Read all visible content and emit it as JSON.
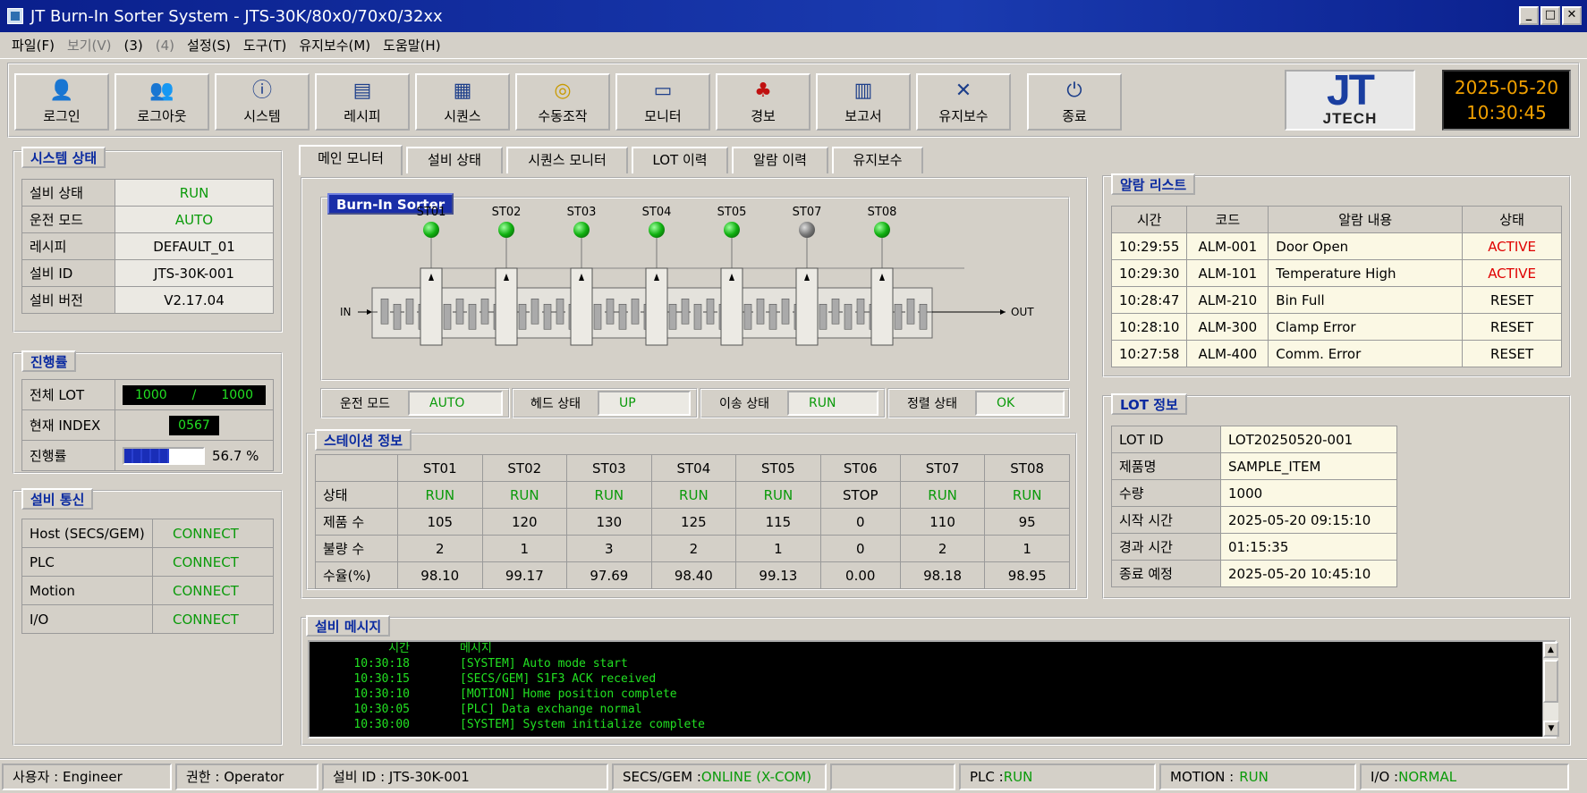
{
  "window": {
    "title": "JT Burn-In Sorter System - JTS-30K/80x0/70x0/32xx"
  },
  "menu": [
    "파일(F)",
    "보기(V)",
    "(3)",
    "(4)",
    "설정(S)",
    "도구(T)",
    "유지보수(M)",
    "도움말(H)"
  ],
  "toolbar": [
    {
      "label": "로그인",
      "icon": "login-icon",
      "glyph": "👤"
    },
    {
      "label": "로그아웃",
      "icon": "logout-icon",
      "glyph": "👥"
    },
    {
      "label": "시스템",
      "icon": "system-icon",
      "glyph": "ⓘ"
    },
    {
      "label": "레시피",
      "icon": "recipe-icon",
      "glyph": "▤"
    },
    {
      "label": "시퀀스",
      "icon": "sequence-icon",
      "glyph": "▦"
    },
    {
      "label": "수동조작",
      "icon": "manual-icon",
      "glyph": "◎"
    },
    {
      "label": "모니터",
      "icon": "monitor-icon",
      "glyph": "▭"
    },
    {
      "label": "경보",
      "icon": "alarm-icon",
      "glyph": "♣"
    },
    {
      "label": "보고서",
      "icon": "report-icon",
      "glyph": "▥"
    },
    {
      "label": "유지보수",
      "icon": "maintenance-icon",
      "glyph": "✕"
    },
    {
      "label": "종료",
      "icon": "exit-icon",
      "glyph": "⏻"
    }
  ],
  "logo": {
    "big": "JT",
    "small": "JTECH"
  },
  "clock": {
    "date": "2025-05-20",
    "time": "10:30:45"
  },
  "system_status": {
    "title": "시스템 상태",
    "rows": [
      {
        "label": "설비 상태",
        "value": "RUN",
        "green": true
      },
      {
        "label": "운전 모드",
        "value": "AUTO",
        "green": true
      },
      {
        "label": "레시피",
        "value": "DEFAULT_01",
        "green": false
      },
      {
        "label": "설비 ID",
        "value": "JTS-30K-001",
        "green": false
      },
      {
        "label": "설비 버전",
        "value": "V2.17.04",
        "green": false
      }
    ]
  },
  "progress": {
    "title": "진행률",
    "total_lot_label": "전체 LOT",
    "total_lot_done": "1000",
    "total_lot_sep": "/",
    "total_lot_total": "1000",
    "index_label": "현재 INDEX",
    "index_value": "0567",
    "rate_label": "진행률",
    "rate_text": "56.7 %",
    "rate_fraction": 0.567
  },
  "comm": {
    "title": "설비 통신",
    "rows": [
      {
        "label": "Host (SECS/GEM)",
        "value": "CONNECT"
      },
      {
        "label": "PLC",
        "value": "CONNECT"
      },
      {
        "label": "Motion",
        "value": "CONNECT"
      },
      {
        "label": "I/O",
        "value": "CONNECT"
      }
    ]
  },
  "tabs": [
    "메인 모니터",
    "설비 상태",
    "시퀀스 모니터",
    "LOT 이력",
    "알람 이력",
    "유지보수"
  ],
  "sorter": {
    "title": "Burn-In Sorter",
    "in_label": "IN",
    "out_label": "OUT",
    "stations": [
      {
        "name": "ST01",
        "led": "green"
      },
      {
        "name": "ST02",
        "led": "green"
      },
      {
        "name": "ST03",
        "led": "green"
      },
      {
        "name": "ST04",
        "led": "green"
      },
      {
        "name": "ST05",
        "led": "green"
      },
      {
        "name": "ST07",
        "led": "gray"
      },
      {
        "name": "ST08",
        "led": "green"
      }
    ]
  },
  "modes": [
    {
      "label": "운전 모드",
      "value": "AUTO"
    },
    {
      "label": "헤드 상태",
      "value": "UP"
    },
    {
      "label": "이송 상태",
      "value": "RUN"
    },
    {
      "label": "정렬 상태",
      "value": "OK"
    }
  ],
  "station_info": {
    "title": "스테이션 정보",
    "headers": [
      "ST01",
      "ST02",
      "ST03",
      "ST04",
      "ST05",
      "ST06",
      "ST07",
      "ST08"
    ],
    "rows": [
      {
        "label": "상태",
        "values": [
          "RUN",
          "RUN",
          "RUN",
          "RUN",
          "RUN",
          "STOP",
          "RUN",
          "RUN"
        ]
      },
      {
        "label": "제품 수",
        "values": [
          "105",
          "120",
          "130",
          "125",
          "115",
          "0",
          "110",
          "95"
        ]
      },
      {
        "label": "불량 수",
        "values": [
          "2",
          "1",
          "3",
          "2",
          "1",
          "0",
          "2",
          "1"
        ]
      },
      {
        "label": "수율(%)",
        "values": [
          "98.10",
          "99.17",
          "97.69",
          "98.40",
          "99.13",
          "0.00",
          "98.18",
          "98.95"
        ]
      }
    ]
  },
  "alarm_list": {
    "title": "알람 리스트",
    "headers": [
      "시간",
      "코드",
      "알람 내용",
      "상태"
    ],
    "rows": [
      {
        "time": "10:29:55",
        "code": "ALM-001",
        "text": "Door Open",
        "state": "ACTIVE"
      },
      {
        "time": "10:29:30",
        "code": "ALM-101",
        "text": "Temperature High",
        "state": "ACTIVE"
      },
      {
        "time": "10:28:47",
        "code": "ALM-210",
        "text": "Bin Full",
        "state": "RESET"
      },
      {
        "time": "10:28:10",
        "code": "ALM-300",
        "text": "Clamp Error",
        "state": "RESET"
      },
      {
        "time": "10:27:58",
        "code": "ALM-400",
        "text": "Comm. Error",
        "state": "RESET"
      }
    ]
  },
  "lot_info": {
    "title": "LOT 정보",
    "rows": [
      {
        "label": "LOT ID",
        "value": "LOT20250520-001"
      },
      {
        "label": "제품명",
        "value": "SAMPLE_ITEM"
      },
      {
        "label": "수량",
        "value": "1000"
      },
      {
        "label": "시작 시간",
        "value": "2025-05-20 09:15:10"
      },
      {
        "label": "경과 시간",
        "value": "01:15:35"
      },
      {
        "label": "종료 예정",
        "value": "2025-05-20 10:45:10"
      }
    ]
  },
  "messages": {
    "title": "설비 메시지",
    "col_time": "시간",
    "col_msg": "메시지",
    "rows": [
      {
        "time": "10:30:18",
        "text": "[SYSTEM] Auto mode start"
      },
      {
        "time": "10:30:15",
        "text": "[SECS/GEM] S1F3 ACK received"
      },
      {
        "time": "10:30:10",
        "text": "[MOTION] Home position complete"
      },
      {
        "time": "10:30:05",
        "text": "[PLC] Data exchange normal"
      },
      {
        "time": "10:30:00",
        "text": "[SYSTEM] System initialize complete"
      }
    ]
  },
  "statusbar": {
    "user": "사용자 : Engineer",
    "auth": "권한 : Operator",
    "equip": "설비 ID : JTS-30K-001",
    "secs_label": "SECS/GEM : ",
    "secs_value": "ONLINE (X-COM)",
    "plc_label": "PLC : ",
    "plc_value": "RUN",
    "motion_label": "MOTION : ",
    "motion_value": "RUN",
    "io_label": "I/O : ",
    "io_value": "NORMAL"
  }
}
